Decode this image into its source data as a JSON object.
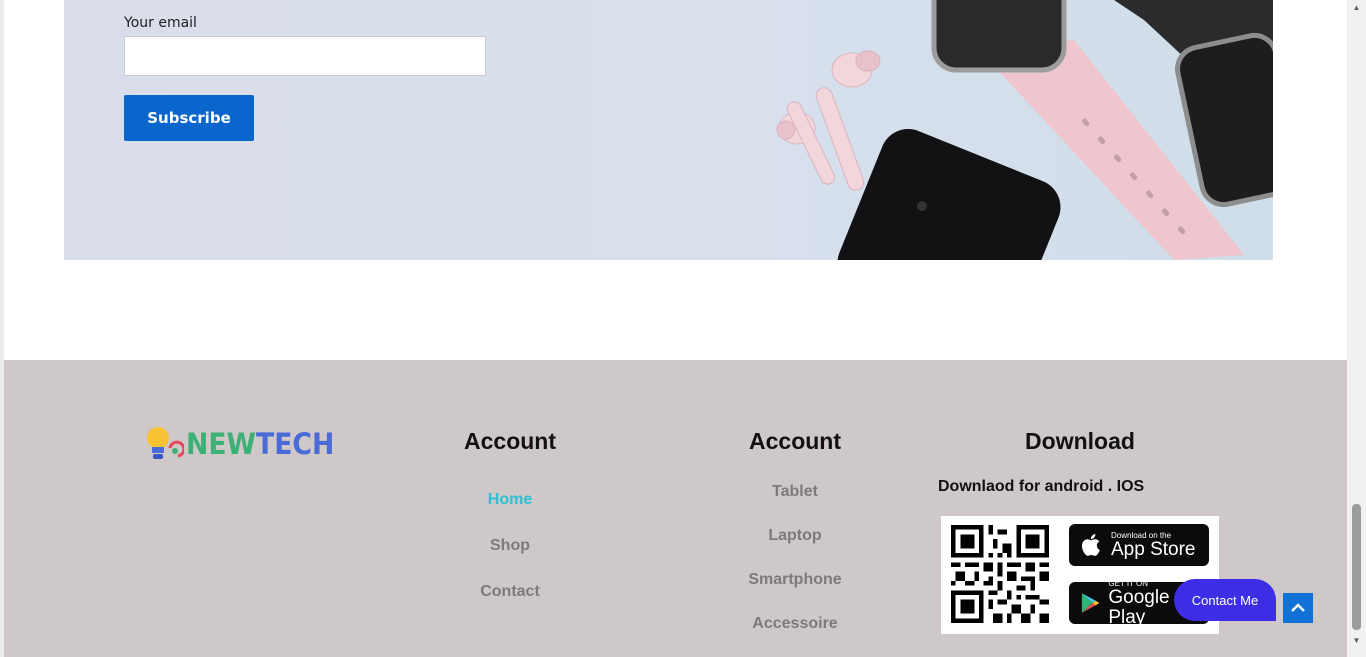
{
  "newsletter": {
    "email_label": "Your email",
    "email_value": "",
    "subscribe_label": "Subscribe"
  },
  "footer": {
    "logo": {
      "part1": "NEW",
      "part2": "TECH"
    },
    "col1": {
      "title": "Account",
      "links": [
        "Home",
        "Shop",
        "Contact"
      ],
      "active_index": 0
    },
    "col2": {
      "title": "Account",
      "links": [
        "Tablet",
        "Laptop",
        "Smartphone",
        "Accessoire"
      ]
    },
    "col3": {
      "title": "Download",
      "subtitle": "Downlaod for android . IOS",
      "app_store": {
        "small": "Download on the",
        "big": "App Store"
      },
      "google_play": {
        "small": "GET IT ON",
        "big": "Google Play"
      }
    }
  },
  "floating": {
    "contact_label": "Contact Me",
    "to_top_icon": "chevron-up-icon"
  },
  "colors": {
    "footer_bg": "#cfc8c8",
    "subscribe": "#0a66cc",
    "active_link": "#29c3d5",
    "contact": "#3d2ee6",
    "to_top": "#1071d6"
  }
}
